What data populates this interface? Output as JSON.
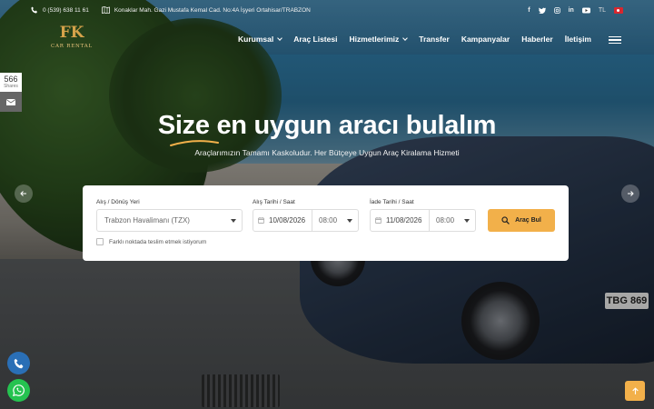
{
  "topbar": {
    "phone": "0 (539) 638 11 61",
    "address": "Konaklar Mah. Gazi Mustafa Kemal Cad. No:4A İşyeri Ortahisar/TRABZON",
    "lang": "TL"
  },
  "logo": {
    "mark": "FK",
    "name": "CAR RENTAL"
  },
  "nav": {
    "items": [
      "Kurumsal",
      "Araç Listesi",
      "Hizmetlerimiz",
      "Transfer",
      "Kampanyalar",
      "Haberler",
      "İletişim"
    ]
  },
  "share": {
    "count": "566",
    "label": "Shares"
  },
  "hero": {
    "headline": "Size en uygun aracı bulalım",
    "subline": "Araçlarımızın Tamamı Kaskoludur. Her Bütçeye Uygun Araç Kiralama Hizmeti"
  },
  "booking": {
    "pickup_label": "Alış / Dönüş Yeri",
    "pickup_value": "Trabzon Havalimanı (TZX)",
    "pickup_date_label": "Alış Tarihi / Saat",
    "pickup_date": "10/08/2026",
    "pickup_time": "08:00",
    "return_date_label": "İade Tarihi / Saat",
    "return_date": "11/08/2026",
    "return_time": "08:00",
    "search_button": "Araç Bul",
    "different_return": "Farklı noktada teslim etmek istiyorum"
  },
  "scene": {
    "plate": "TBG 869"
  },
  "colors": {
    "accent": "#f2b04a",
    "phone_fab": "#2a6fb6",
    "whatsapp_fab": "#25c350"
  }
}
